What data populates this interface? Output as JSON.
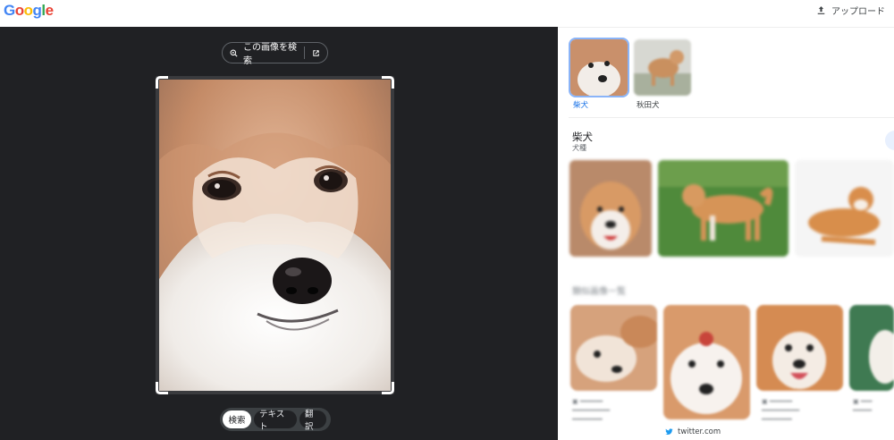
{
  "header": {
    "logo": "Google",
    "upload_label": "アップロード",
    "upload_icon": "upload-icon"
  },
  "lens": {
    "search_chip_label": "この画像を検索",
    "search_icon": "lens-search-icon",
    "open_icon": "open-in-new-icon",
    "modes": [
      "検索",
      "テキスト",
      "翻訳"
    ],
    "active_mode": "検索"
  },
  "results": {
    "tags": [
      {
        "label": "柴犬",
        "selected": true
      },
      {
        "label": "秋田犬",
        "selected": false
      }
    ],
    "entity": {
      "title": "柴犬",
      "subtitle": "犬種"
    },
    "section_heading": "類似画像一覧",
    "sources": [
      {
        "name": "twitter.com",
        "icon": "twitter-bird-icon"
      }
    ]
  },
  "colors": {
    "lens_background": "#202124",
    "accent_blue": "#1a73e8",
    "selected_outline": "#8ab4f8"
  }
}
